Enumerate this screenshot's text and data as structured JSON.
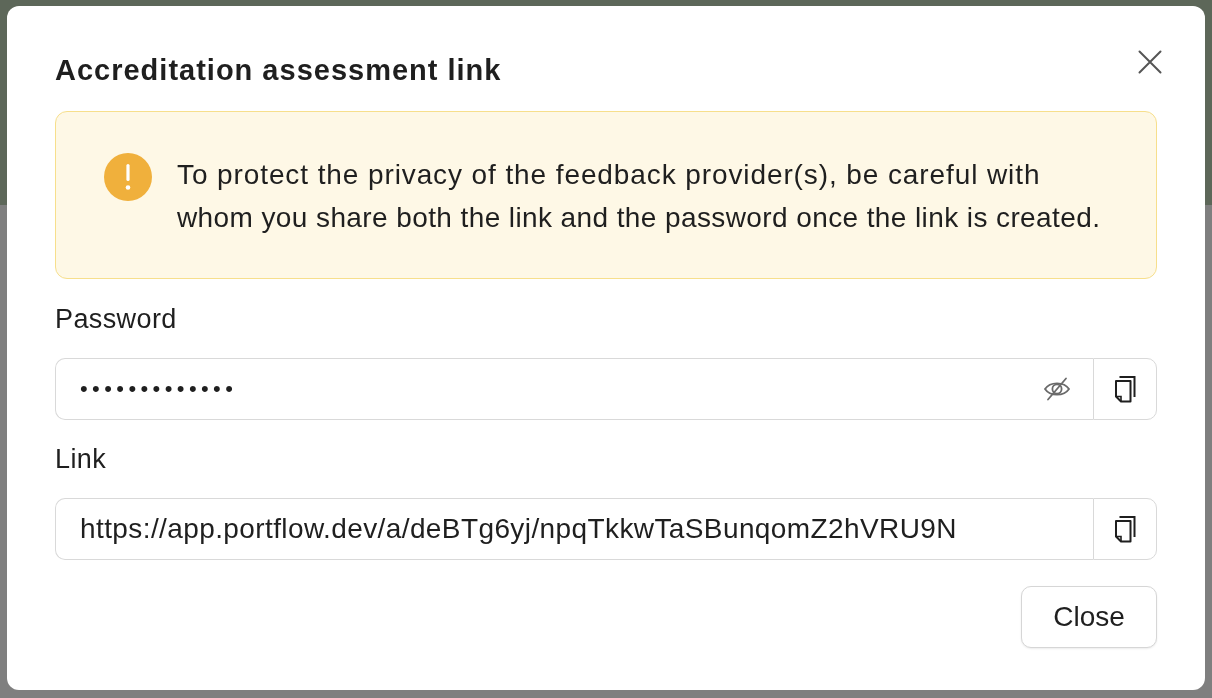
{
  "dialog": {
    "title": "Accreditation assessment link",
    "alert": {
      "kind": "warning",
      "text": "To protect the privacy of the feedback provider(s), be careful with whom you share both the link and the password once the link is created."
    },
    "fields": [
      {
        "kind": "password",
        "label": "Password",
        "value": "•••••••••••••",
        "revealed": false
      },
      {
        "kind": "link",
        "label": "Link",
        "value": "https://app.portflow.dev/a/deBTg6yj/npqTkkwTaSBunqomZ2hVRU9N"
      }
    ],
    "buttons": [
      "Close"
    ]
  }
}
